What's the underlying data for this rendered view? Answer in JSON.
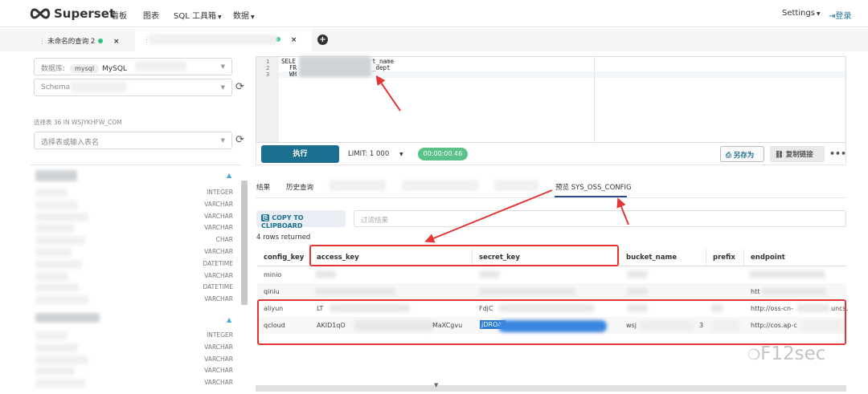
{
  "nav": {
    "brand": "Superset",
    "items": [
      "看板",
      "图表",
      "SQL 工具箱",
      "数据"
    ],
    "settings": "Settings",
    "login": "登录"
  },
  "query_tabs": [
    {
      "label": "未命名的查询 2",
      "close": "×"
    },
    {
      "label": "",
      "close": "×"
    }
  ],
  "add_tab": "+",
  "left": {
    "db_label": "数据库:",
    "db_badge": "mysql",
    "db_value": "MySQL",
    "schema_label": "Schema",
    "select_table_label": "选择表 36 IN WSJYKHFW_COM",
    "table_placeholder": "选择表或输入表名",
    "columns_group1": [
      "INTEGER",
      "VARCHAR",
      "VARCHAR",
      "VARCHAR",
      "CHAR",
      "VARCHAR",
      "DATETIME",
      "VARCHAR",
      "DATETIME",
      "VARCHAR"
    ],
    "columns_group2": [
      "INTEGER",
      "VARCHAR",
      "VARCHAR",
      "VARCHAR",
      "VARCHAR"
    ]
  },
  "editor": {
    "line_numbers": [
      "1",
      "2",
      "3"
    ],
    "line1_a": "SELE",
    "line1_b": "t_name",
    "line2_a": "FR",
    "line2_b": "_dept",
    "line3_a": "WH"
  },
  "toolbar": {
    "run": "执行",
    "limit": "LIMIT: 1 000",
    "timer": "00:00:00.46",
    "save_as": "另存为",
    "copy_link": "复制链接",
    "more": "•••"
  },
  "result_tabs": [
    "结果",
    "历史查询",
    "预览 SYS_OSS_CONFIG"
  ],
  "results": {
    "copy_clipboard": "COPY TO CLIPBOARD",
    "filter_placeholder": "过滤结果",
    "rows_returned": "4 rows returned",
    "columns": [
      "config_key",
      "access_key",
      "secret_key",
      "bucket_name",
      "prefix",
      "endpoint"
    ],
    "rows": [
      {
        "config_key": "minio",
        "access_key": "",
        "secret_key": "",
        "bucket_name": "",
        "prefix": "",
        "endpoint": ""
      },
      {
        "config_key": "qiniu",
        "access_key": "",
        "secret_key": "",
        "bucket_name": "",
        "prefix": "",
        "endpoint": "htt"
      },
      {
        "config_key": "aliyun",
        "access_key": "LT",
        "secret_key": "FdjC",
        "bucket_name": "",
        "prefix": "",
        "endpoint": "http://oss-cn-"
      },
      {
        "config_key": "qcloud",
        "access_key": "AKID1qO",
        "secret_key": "jDROAI",
        "bucket_name": "wsj",
        "prefix": "",
        "endpoint": "http://cos.ap-c"
      }
    ],
    "access_key_suffix": "MaXCgvu",
    "bucket_suffix": "3",
    "aliyun_endpoint_suffix": "uncs."
  },
  "watermark": "F12sec",
  "colors": {
    "accent": "#1d6f8f",
    "annotation_red": "#e23636",
    "success": "#5ac189"
  }
}
